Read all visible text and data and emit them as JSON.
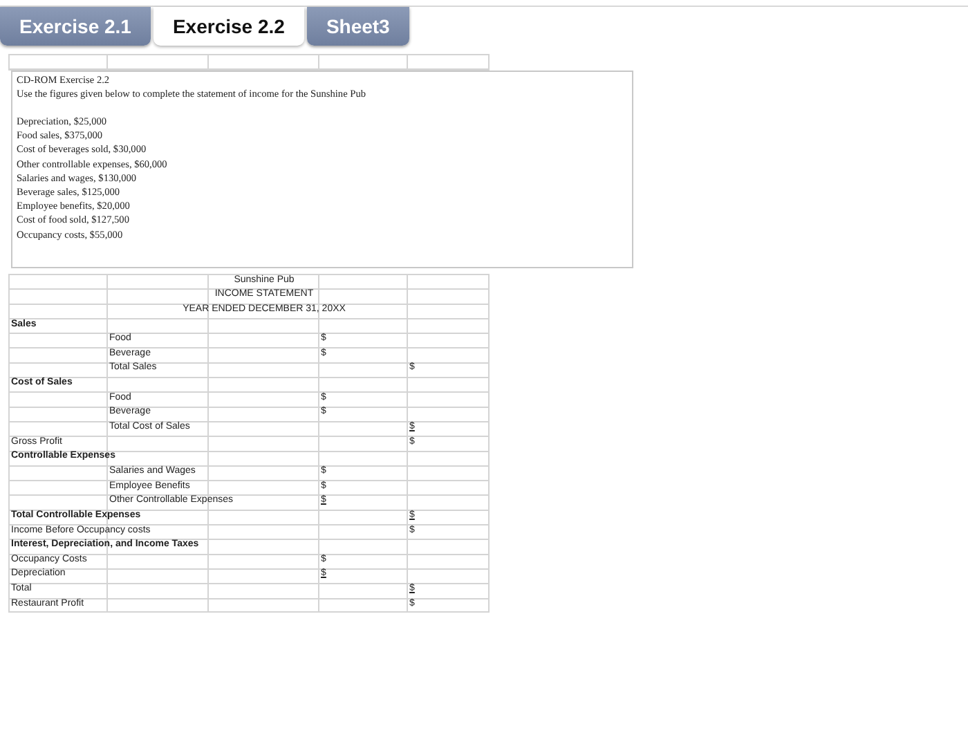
{
  "tabs": [
    {
      "label": "Exercise 2.1",
      "selected": false
    },
    {
      "label": "Exercise 2.2",
      "selected": true
    },
    {
      "label": "Sheet3",
      "selected": false
    }
  ],
  "note": {
    "heading": "CD-ROM Exercise 2.2",
    "instruction": "Use the figures given below to complete the statement of income for the Sunshine Pub",
    "figures": [
      "Depreciation, $25,000",
      "Food sales, $375,000",
      "Cost of beverages sold, $30,000",
      "Other controllable expenses, $60,000",
      "Salaries and wages, $130,000",
      "Beverage sales, $125,000",
      "Employee benefits, $20,000",
      "Cost of food sold, $127,500",
      "Occupancy costs, $55,000"
    ]
  },
  "statement": {
    "rows": [
      {
        "kind": "title",
        "text": "Sunshine Pub"
      },
      {
        "kind": "title",
        "text": "INCOME STATEMENT"
      },
      {
        "kind": "title",
        "text": "YEAR ENDED DECEMBER 31, 20XX"
      },
      {
        "kind": "line",
        "label": "Sales",
        "bold": true
      },
      {
        "kind": "line",
        "item": "Food",
        "subtotal": {
          "text": "$",
          "underlined": false
        }
      },
      {
        "kind": "line",
        "item": "Beverage",
        "subtotal": {
          "text": "$",
          "underlined": false
        }
      },
      {
        "kind": "line",
        "item": "Total Sales",
        "total": {
          "text": "$",
          "underlined": false
        }
      },
      {
        "kind": "line",
        "label": "Cost of Sales",
        "bold": true
      },
      {
        "kind": "line",
        "item": "Food",
        "subtotal": {
          "text": "$",
          "underlined": false
        }
      },
      {
        "kind": "line",
        "item": "Beverage",
        "subtotal": {
          "text": "$",
          "underlined": false
        }
      },
      {
        "kind": "line",
        "item": "Total Cost of Sales",
        "total": {
          "text": "$",
          "underlined": true
        }
      },
      {
        "kind": "line",
        "label": "Gross Profit",
        "bold": false,
        "total": {
          "text": "$",
          "underlined": false
        }
      },
      {
        "kind": "line",
        "label": "Controllable Expenses",
        "bold": true
      },
      {
        "kind": "line",
        "item": "Salaries and Wages",
        "subtotal": {
          "text": "$",
          "underlined": false
        }
      },
      {
        "kind": "line",
        "item": "Employee Benefits",
        "subtotal": {
          "text": "$",
          "underlined": false
        }
      },
      {
        "kind": "line",
        "item": "Other Controllable Expenses",
        "subtotal": {
          "text": "$",
          "underlined": true
        }
      },
      {
        "kind": "line",
        "label": "Total Controllable Expenses",
        "bold": true,
        "total": {
          "text": "$",
          "underlined": true
        }
      },
      {
        "kind": "line",
        "label": "Income Before Occupancy costs",
        "bold": false,
        "total": {
          "text": "$",
          "underlined": false
        }
      },
      {
        "kind": "line",
        "label": "Interest, Depreciation, and Income Taxes",
        "bold": true
      },
      {
        "kind": "line",
        "label": "Occupancy Costs",
        "bold": false,
        "subtotal": {
          "text": "$",
          "underlined": false
        }
      },
      {
        "kind": "line",
        "label": "Depreciation",
        "bold": false,
        "subtotal": {
          "text": "$",
          "underlined": true
        }
      },
      {
        "kind": "line",
        "label": "Total",
        "bold": false,
        "total": {
          "text": "$",
          "underlined": true
        }
      },
      {
        "kind": "line",
        "label": "Restaurant Profit",
        "bold": false,
        "total": {
          "text": "$",
          "underlined": false
        }
      }
    ]
  }
}
